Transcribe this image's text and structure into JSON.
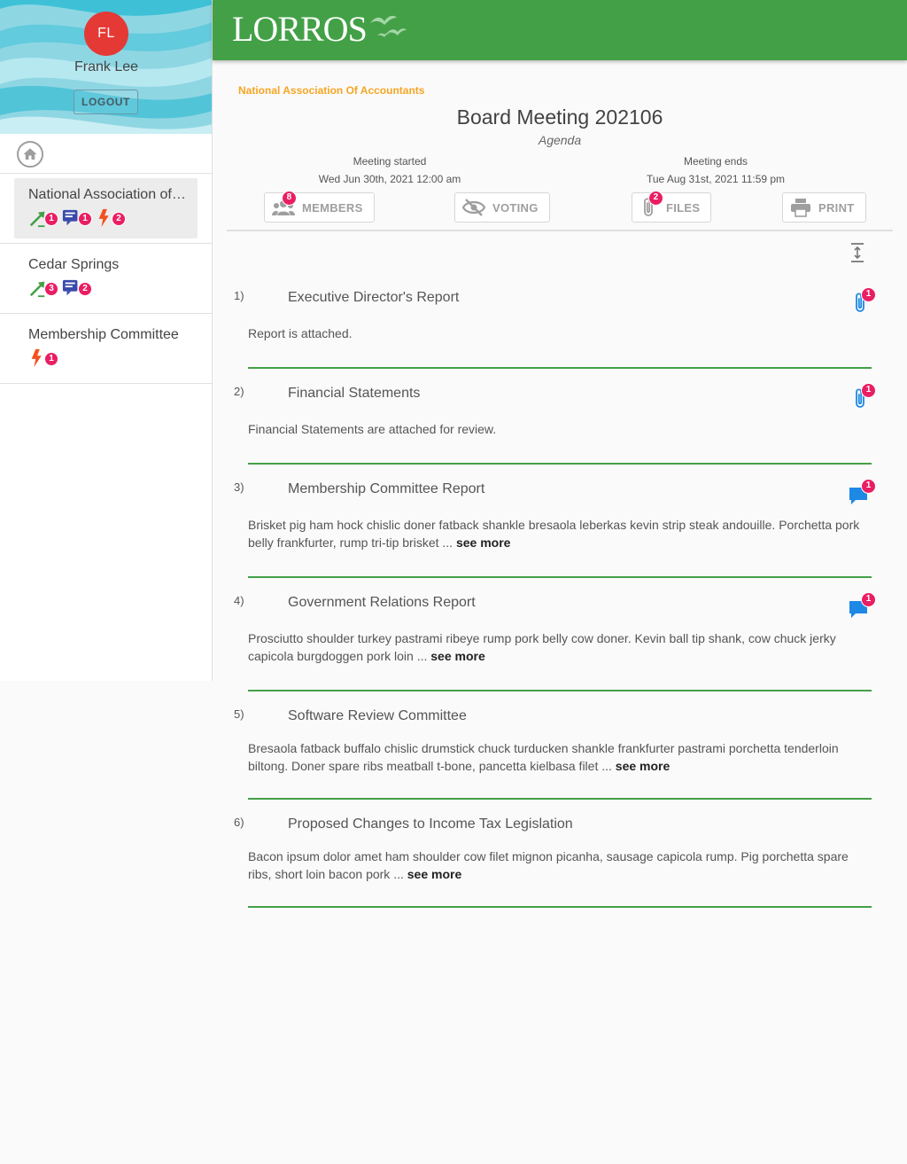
{
  "user": {
    "initials": "FL",
    "name": "Frank Lee",
    "logout_label": "LOGOUT"
  },
  "sidebar": {
    "items": [
      {
        "label": "National Association of Accountants",
        "counts": {
          "motions": "1",
          "discussions": "1",
          "urgent": "2"
        }
      },
      {
        "label": "Cedar Springs",
        "counts": {
          "motions": "3",
          "discussions": "2"
        }
      },
      {
        "label": "Membership Committee",
        "counts": {
          "urgent": "1"
        }
      }
    ]
  },
  "header": {
    "logo_text": "LORROS"
  },
  "meeting": {
    "organization": "National Association Of Accountants",
    "title": "Board Meeting 202106",
    "subtitle": "Agenda",
    "started_label": "Meeting started",
    "started_value": "Wed Jun 30th, 2021 12:00 am",
    "ends_label": "Meeting ends",
    "ends_value": "Tue Aug 31st, 2021 11:59 pm"
  },
  "toolbar": {
    "members": {
      "label": "MEMBERS",
      "badge": "8"
    },
    "voting": {
      "label": "VOTING"
    },
    "files": {
      "label": "FILES",
      "badge": "2"
    },
    "print": {
      "label": "PRINT"
    }
  },
  "agenda": [
    {
      "num": "1)",
      "title": "Executive Director's Report",
      "desc": "Report is attached.",
      "more": "",
      "icon": "attachment-icon",
      "badge": "1"
    },
    {
      "num": "2)",
      "title": "Financial Statements",
      "desc": "Financial Statements are attached for review.",
      "more": "",
      "icon": "attachment-icon",
      "badge": "1"
    },
    {
      "num": "3)",
      "title": "Membership Committee Report",
      "desc": "Brisket pig ham hock chislic doner fatback shankle bresaola leberkas kevin strip steak andouille. Porchetta pork belly frankfurter, rump tri-tip brisket ... ",
      "more": "see more",
      "icon": "comment-icon",
      "badge": "1"
    },
    {
      "num": "4)",
      "title": "Government Relations Report",
      "desc": "Prosciutto shoulder turkey pastrami ribeye rump pork belly cow doner. Kevin ball tip shank, cow chuck jerky capicola burgdoggen pork loin ... ",
      "more": "see more",
      "icon": "comment-icon",
      "badge": "1"
    },
    {
      "num": "5)",
      "title": "Software Review Committee",
      "desc": "Bresaola fatback buffalo chislic drumstick chuck turducken shankle frankfurter pastrami porchetta tenderloin biltong. Doner spare ribs meatball t-bone, pancetta kielbasa filet ... ",
      "more": "see more",
      "icon": "",
      "badge": ""
    },
    {
      "num": "6)",
      "title": "Proposed Changes to Income Tax Legislation",
      "desc": "Bacon ipsum dolor amet ham shoulder cow filet mignon picanha, sausage capicola rump. Pig porchetta spare ribs, short loin bacon pork ... ",
      "more": "see more",
      "icon": "",
      "badge": ""
    }
  ],
  "colors": {
    "header": "#43a047",
    "accent_orange": "#f5a623",
    "badge": "#e91e63",
    "avatar": "#e53935",
    "icon_blue": "#1e88e5"
  }
}
